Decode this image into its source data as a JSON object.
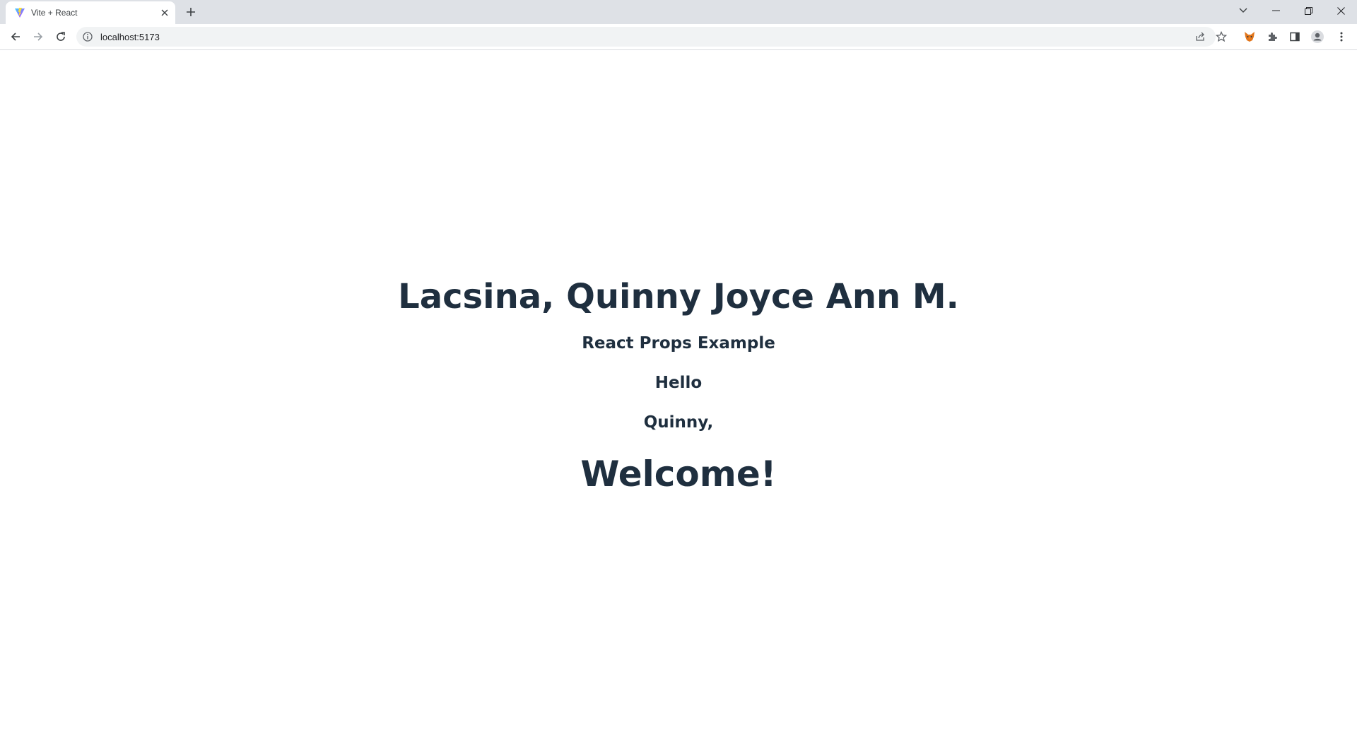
{
  "browser": {
    "tab": {
      "title": "Vite + React"
    },
    "address": {
      "url": "localhost:5173"
    },
    "icons": {
      "favicon": "vite-logo-icon",
      "tab_close": "close-icon",
      "new_tab": "plus-icon",
      "tab_search": "chevron-down-icon",
      "minimize": "minimize-icon",
      "restore": "restore-icon",
      "close_window": "close-icon",
      "back": "arrow-left-icon",
      "forward": "arrow-right-icon",
      "reload": "reload-icon",
      "site_info": "info-icon",
      "share": "share-icon",
      "bookmark": "star-icon",
      "extension_fox": "fox-extension-icon",
      "extensions": "puzzle-icon",
      "side_panel": "side-panel-icon",
      "profile": "profile-icon",
      "menu": "kebab-menu-icon"
    },
    "colors": {
      "tabstrip_bg": "#dee1e6",
      "omnibox_bg": "#f1f3f4",
      "heading_text": "#1f2f3f"
    }
  },
  "page": {
    "name_heading": "Lacsina, Quinny Joyce Ann M.",
    "subtitle": "React Props Example",
    "greeting": "Hello",
    "first_name": "Quinny,",
    "welcome": "Welcome!"
  }
}
